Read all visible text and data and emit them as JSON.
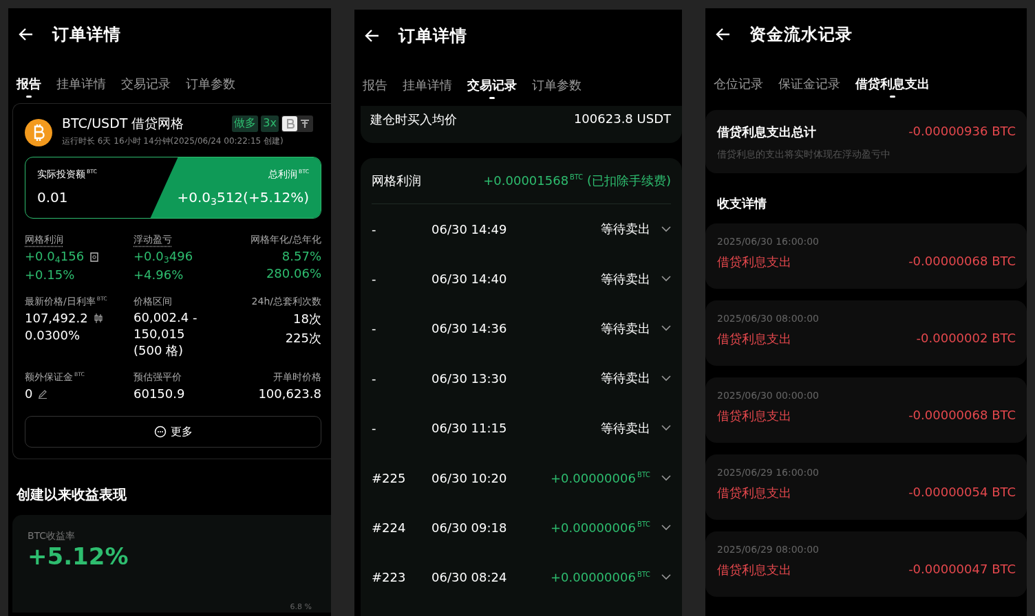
{
  "report_screen": {
    "title": "订单详情",
    "tabs": [
      {
        "label": "报告",
        "selected": true
      },
      {
        "label": "挂单详情",
        "selected": false
      },
      {
        "label": "交易记录",
        "selected": false
      },
      {
        "label": "订单参数",
        "selected": false
      }
    ],
    "bot": {
      "name": "BTC/USDT 借贷网格",
      "tags": [
        "做多",
        "3x"
      ],
      "runtime": "运行时长 6天 16小时 14分钟(2025/06/24 00:22:15 创建)",
      "investment_label": "实际投资额$^{BTC}$",
      "investment": "0.01",
      "profit_label": "总利润$^{BTC}$",
      "profit": "+0.0$_{3}$512(+5.12%)",
      "stats": [
        {
          "label": "网格利润",
          "underlined": true,
          "kind": "fee",
          "positive": true,
          "values": [
            "+0.0$_{4}$156",
            "+0.15%"
          ]
        },
        {
          "label": "浮动盈亏",
          "underlined": true,
          "kind": "plain",
          "positive": true,
          "values": [
            "+0.0$_{3}$496",
            "+4.96%"
          ]
        },
        {
          "label": "网格年化/总年化",
          "underlined": false,
          "kind": "plain",
          "positive": true,
          "values": [
            "8.57%",
            "280.06%"
          ]
        },
        {
          "label": "最新价格/日利率$^{BTC}$",
          "underlined": false,
          "kind": "chart",
          "positive": false,
          "values": [
            "107,492.2",
            "0.0300%"
          ]
        },
        {
          "label": "价格区间",
          "underlined": false,
          "kind": "plain",
          "positive": false,
          "values": [
            "60,002.4 -",
            "150,015",
            "(500 格)"
          ]
        },
        {
          "label": "24h/总套利次数",
          "underlined": false,
          "kind": "plain",
          "positive": false,
          "values": [
            "18次",
            "225次"
          ]
        },
        {
          "label": "额外保证金$^{BTC}$",
          "underlined": false,
          "kind": "editable",
          "positive": false,
          "values": [
            "0"
          ]
        },
        {
          "label": "预估强平价",
          "underlined": false,
          "kind": "plain",
          "positive": false,
          "values": [
            "60150.9"
          ]
        },
        {
          "label": "开单时价格",
          "underlined": false,
          "kind": "plain",
          "positive": false,
          "values": [
            "100,623.8"
          ]
        }
      ],
      "more_button": "更多"
    },
    "section_title": "创建以来收益表现",
    "performance": {
      "label": "BTC收益率",
      "value": "+5.12%",
      "axis_label": "6.8 %"
    }
  },
  "trades_screen": {
    "title": "订单详情",
    "tabs": [
      {
        "label": "报告",
        "selected": false
      },
      {
        "label": "挂单详情",
        "selected": false
      },
      {
        "label": "交易记录",
        "selected": true
      },
      {
        "label": "订单参数",
        "selected": false
      }
    ],
    "entry_price": {
      "label": "建仓时买入均价",
      "value": "100623.8 USDT"
    },
    "grid_profit": {
      "label": "网格利润",
      "value": "+0.00001568$^{BTC}$ (已扣除手续费)"
    },
    "records": [
      {
        "kind": "pending",
        "id": "-",
        "time": "06/30 14:49",
        "status": "等待卖出"
      },
      {
        "kind": "pending",
        "id": "-",
        "time": "06/30 14:40",
        "status": "等待卖出"
      },
      {
        "kind": "pending",
        "id": "-",
        "time": "06/30 14:36",
        "status": "等待卖出"
      },
      {
        "kind": "pending",
        "id": "-",
        "time": "06/30 13:30",
        "status": "等待卖出"
      },
      {
        "kind": "pending",
        "id": "-",
        "time": "06/30 11:15",
        "status": "等待卖出"
      },
      {
        "kind": "profit",
        "id": "#225",
        "time": "06/30 10:20",
        "status": "+0.00000006$^{BTC}$"
      },
      {
        "kind": "profit",
        "id": "#224",
        "time": "06/30 09:18",
        "status": "+0.00000006$^{BTC}$"
      },
      {
        "kind": "profit",
        "id": "#223",
        "time": "06/30 08:24",
        "status": "+0.00000006$^{BTC}$"
      }
    ]
  },
  "funding_screen": {
    "title": "资金流水记录",
    "tabs": [
      {
        "label": "仓位记录",
        "selected": false
      },
      {
        "label": "保证金记录",
        "selected": false
      },
      {
        "label": "借贷利息支出",
        "selected": true
      }
    ],
    "summary": {
      "label": "借贷利息支出总计",
      "amount": "-0.00000936 BTC",
      "note": "借贷利息的支出将实时体现在浮动盈亏中"
    },
    "section_title": "收支详情",
    "entries": [
      {
        "time": "2025/06/30 16:00:00",
        "label": "借贷利息支出",
        "amount": "-0.00000068 BTC"
      },
      {
        "time": "2025/06/30 08:00:00",
        "label": "借贷利息支出",
        "amount": "-0.0000002 BTC"
      },
      {
        "time": "2025/06/30 00:00:00",
        "label": "借贷利息支出",
        "amount": "-0.00000068 BTC"
      },
      {
        "time": "2025/06/29 16:00:00",
        "label": "借贷利息支出",
        "amount": "-0.00000054 BTC"
      },
      {
        "time": "2025/06/29 08:00:00",
        "label": "借贷利息支出",
        "amount": "-0.00000047 BTC"
      }
    ]
  }
}
